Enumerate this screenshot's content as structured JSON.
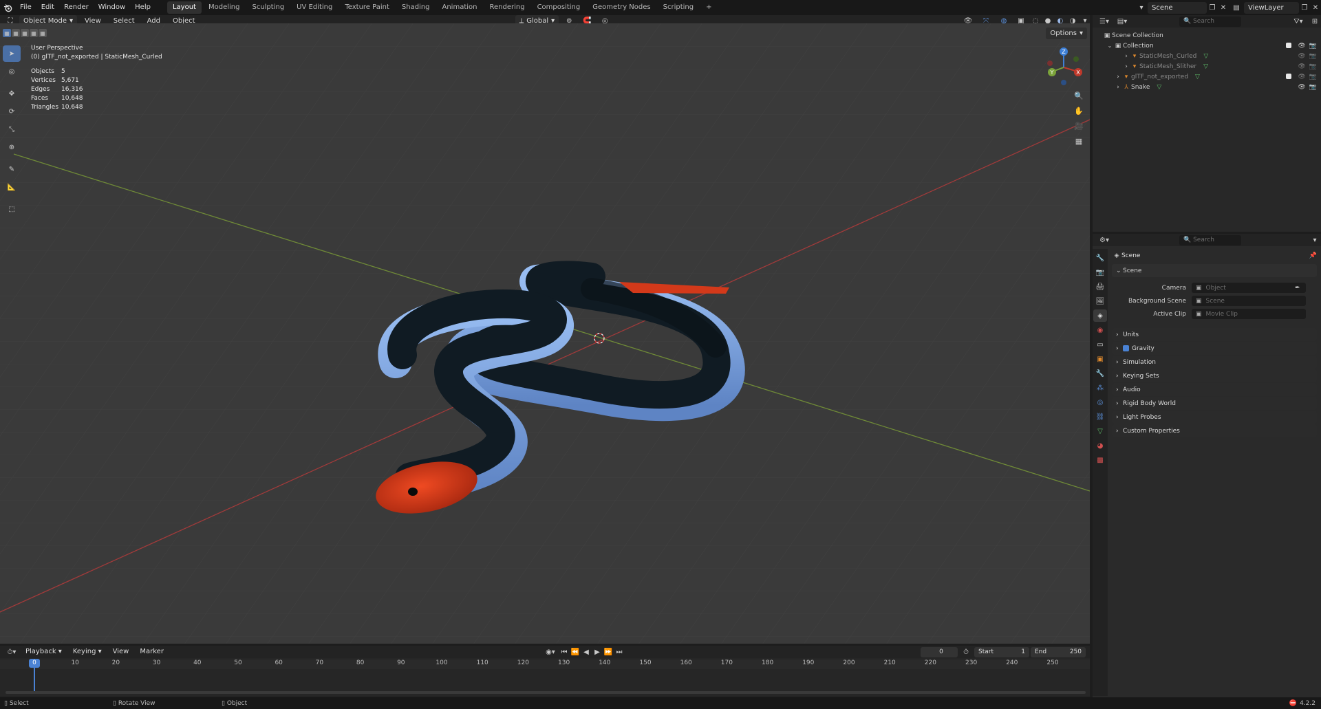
{
  "menus": [
    "File",
    "Edit",
    "Render",
    "Window",
    "Help"
  ],
  "workspaces": [
    {
      "label": "Layout",
      "active": true
    },
    {
      "label": "Modeling",
      "active": false
    },
    {
      "label": "Sculpting",
      "active": false
    },
    {
      "label": "UV Editing",
      "active": false
    },
    {
      "label": "Texture Paint",
      "active": false
    },
    {
      "label": "Shading",
      "active": false
    },
    {
      "label": "Animation",
      "active": false
    },
    {
      "label": "Rendering",
      "active": false
    },
    {
      "label": "Compositing",
      "active": false
    },
    {
      "label": "Geometry Nodes",
      "active": false
    },
    {
      "label": "Scripting",
      "active": false
    }
  ],
  "add_workspace": "+",
  "scene_name": "Scene",
  "view_layer": "ViewLayer",
  "viewport_header": {
    "mode": "Object Mode",
    "menus": [
      "View",
      "Select",
      "Add",
      "Object"
    ],
    "orientation": "Global",
    "options": "Options"
  },
  "overlay": {
    "perspective": "User Perspective",
    "active": "(0) glTF_not_exported | StaticMesh_Curled",
    "stats": [
      {
        "label": "Objects",
        "value": "5"
      },
      {
        "label": "Vertices",
        "value": "5,671"
      },
      {
        "label": "Edges",
        "value": "16,316"
      },
      {
        "label": "Faces",
        "value": "10,648"
      },
      {
        "label": "Triangles",
        "value": "10,648"
      }
    ]
  },
  "gizmo_axes": {
    "x": "X",
    "y": "Y",
    "z": "Z"
  },
  "outliner": {
    "search_placeholder": "Search",
    "root": "Scene Collection",
    "collection": "Collection",
    "items": [
      {
        "label": "StaticMesh_Curled",
        "indent": 2,
        "dim": true
      },
      {
        "label": "StaticMesh_Slither",
        "indent": 2,
        "dim": true
      },
      {
        "label": "glTF_not_exported",
        "indent": 1,
        "dim": true
      },
      {
        "label": "Snake",
        "indent": 1,
        "dim": false
      }
    ]
  },
  "properties": {
    "search_placeholder": "Search",
    "context": "Scene",
    "section": "Scene",
    "fields": [
      {
        "label": "Camera",
        "placeholder": "Object"
      },
      {
        "label": "Background Scene",
        "placeholder": "Scene"
      },
      {
        "label": "Active Clip",
        "placeholder": "Movie Clip"
      }
    ],
    "panels": [
      "Units",
      "Gravity",
      "Simulation",
      "Keying Sets",
      "Audio",
      "Rigid Body World",
      "Light Probes",
      "Custom Properties"
    ]
  },
  "timeline": {
    "menus": [
      "Playback",
      "Keying",
      "View",
      "Marker"
    ],
    "current_frame": "0",
    "start_label": "Start",
    "start": "1",
    "end_label": "End",
    "end": "250",
    "ticks": [
      "0",
      "10",
      "20",
      "30",
      "40",
      "50",
      "60",
      "70",
      "80",
      "90",
      "100",
      "110",
      "120",
      "130",
      "140",
      "150",
      "160",
      "170",
      "180",
      "190",
      "200",
      "210",
      "220",
      "230",
      "240",
      "250"
    ]
  },
  "statusbar": {
    "items": [
      "Select",
      "Rotate View",
      "Object"
    ],
    "version": "4.2.2"
  },
  "colors": {
    "accent": "#4a6fa5",
    "x_axis": "#c0392b",
    "y_axis": "#7ba33a",
    "z_axis": "#3d7fd6",
    "snake_body": "#101b23",
    "snake_belly": "#7fa6e0",
    "snake_red": "#d33a1a"
  }
}
